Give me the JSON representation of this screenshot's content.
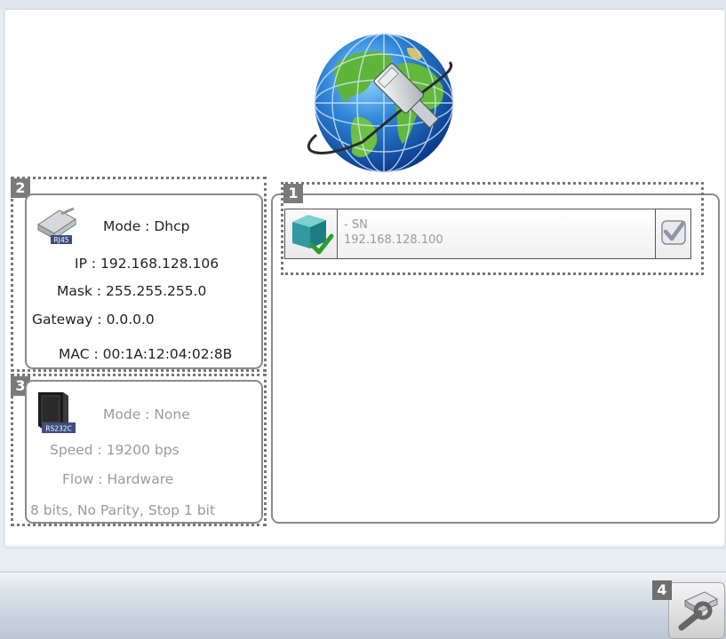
{
  "callouts": {
    "device": "1",
    "ethernet": "2",
    "serial": "3",
    "settings": "4"
  },
  "device": {
    "name": "- SN",
    "ip": "192.168.128.100",
    "selected": true
  },
  "ethernet": {
    "icon_label": "RJ45",
    "mode_label": "Mode :",
    "mode_value": "Dhcp",
    "ip_label": "IP :",
    "ip_value": "192.168.128.106",
    "mask_label": "Mask :",
    "mask_value": "255.255.255.0",
    "gateway_label": "Gateway :",
    "gateway_value": "0.0.0.0",
    "mac_label": "MAC :",
    "mac_value": "00:1A:12:04:02:8B"
  },
  "serial": {
    "icon_label": "RS232C",
    "mode_label": "Mode :",
    "mode_value": "None",
    "speed_label": "Speed :",
    "speed_value": "19200 bps",
    "flow_label": "Flow :",
    "flow_value": "Hardware",
    "format": "8 bits, No Parity, Stop 1 bit"
  },
  "icons": {
    "globe": "globe-network-cable-icon",
    "ethernet": "ethernet-connector-icon",
    "serial": "serial-port-icon",
    "device": "device-connected-icon",
    "checkbox": "checkbox-checked-icon",
    "settings": "wrench-settings-icon"
  }
}
